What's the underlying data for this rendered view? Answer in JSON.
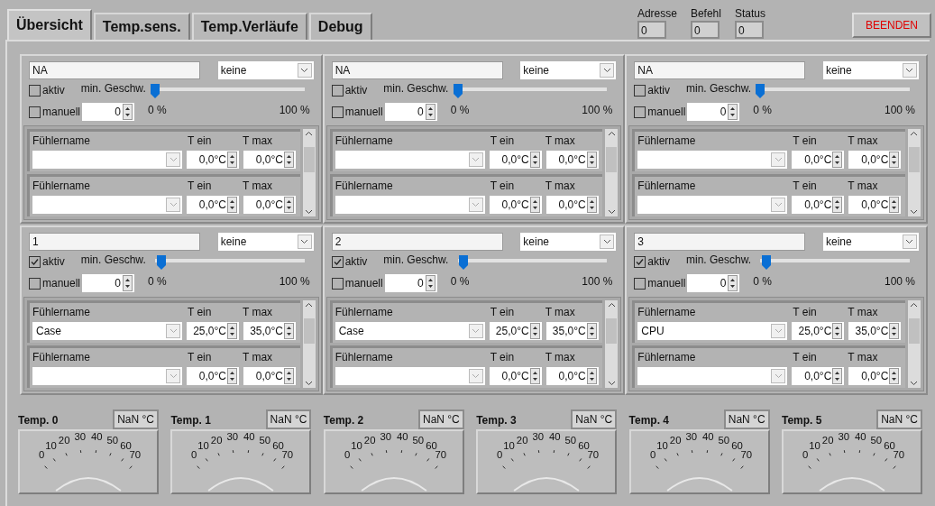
{
  "tabs": [
    {
      "label": "Übersicht",
      "selected": true
    },
    {
      "label": "Temp.sens.",
      "selected": false
    },
    {
      "label": "Temp.Verläufe",
      "selected": false
    },
    {
      "label": "Debug",
      "selected": false
    }
  ],
  "indicators": [
    {
      "label": "Adresse",
      "value": "0"
    },
    {
      "label": "Befehl",
      "value": "0"
    },
    {
      "label": "Status",
      "value": "0"
    }
  ],
  "quit_button": "BEENDEN",
  "panels": [
    {
      "name": "NA",
      "mode": "keine",
      "aktiv_label": "aktiv",
      "aktiv": false,
      "manuell_label": "manuell",
      "manuell": false,
      "manual_value": "0",
      "speed_label": "min. Geschw.",
      "level": 0,
      "scale_min": "0 %",
      "scale_max": "100 %",
      "sensors": [
        {
          "name_label": "Fühlername",
          "t_on_label": "T ein",
          "t_on": "0,0°C",
          "t_max_label": "T max",
          "t_max": "0,0°C"
        },
        {
          "name_label": "Fühlername",
          "t_on_label": "T ein",
          "t_on": "0,0°C",
          "t_max_label": "T max",
          "t_max": "0,0°C"
        }
      ]
    },
    {
      "name": "NA",
      "mode": "keine",
      "aktiv_label": "aktiv",
      "aktiv": false,
      "manuell_label": "manuell",
      "manuell": false,
      "manual_value": "0",
      "speed_label": "min. Geschw.",
      "level": 0,
      "scale_min": "0 %",
      "scale_max": "100 %",
      "sensors": [
        {
          "name_label": "Fühlername",
          "t_on_label": "T ein",
          "t_on": "0,0°C",
          "t_max_label": "T max",
          "t_max": "0,0°C"
        },
        {
          "name_label": "Fühlername",
          "t_on_label": "T ein",
          "t_on": "0,0°C",
          "t_max_label": "T max",
          "t_max": "0,0°C"
        }
      ]
    },
    {
      "name": "NA",
      "mode": "keine",
      "aktiv_label": "aktiv",
      "aktiv": false,
      "manuell_label": "manuell",
      "manuell": false,
      "manual_value": "0",
      "speed_label": "min. Geschw.",
      "level": 0,
      "scale_min": "0 %",
      "scale_max": "100 %",
      "sensors": [
        {
          "name_label": "Fühlername",
          "t_on_label": "T ein",
          "t_on": "0,0°C",
          "t_max_label": "T max",
          "t_max": "0,0°C"
        },
        {
          "name_label": "Fühlername",
          "t_on_label": "T ein",
          "t_on": "0,0°C",
          "t_max_label": "T max",
          "t_max": "0,0°C"
        }
      ]
    },
    {
      "name": "1",
      "mode": "keine",
      "aktiv_label": "aktiv",
      "aktiv": true,
      "manuell_label": "manuell",
      "manuell": false,
      "manual_value": "0",
      "speed_label": "min. Geschw.",
      "level": 0.04,
      "scale_min": "0 %",
      "scale_max": "100 %",
      "sensors": [
        {
          "name_label": "Fühlername",
          "sensor": "Case",
          "t_on_label": "T ein",
          "t_on": "25,0°C",
          "t_max_label": "T max",
          "t_max": "35,0°C"
        },
        {
          "name_label": "Fühlername",
          "t_on_label": "T ein",
          "t_on": "0,0°C",
          "t_max_label": "T max",
          "t_max": "0,0°C"
        }
      ]
    },
    {
      "name": "2",
      "mode": "keine",
      "aktiv_label": "aktiv",
      "aktiv": true,
      "manuell_label": "manuell",
      "manuell": false,
      "manual_value": "0",
      "speed_label": "min. Geschw.",
      "level": 0.04,
      "scale_min": "0 %",
      "scale_max": "100 %",
      "sensors": [
        {
          "name_label": "Fühlername",
          "sensor": "Case",
          "t_on_label": "T ein",
          "t_on": "25,0°C",
          "t_max_label": "T max",
          "t_max": "35,0°C"
        },
        {
          "name_label": "Fühlername",
          "t_on_label": "T ein",
          "t_on": "0,0°C",
          "t_max_label": "T max",
          "t_max": "0,0°C"
        }
      ]
    },
    {
      "name": "3",
      "mode": "keine",
      "aktiv_label": "aktiv",
      "aktiv": true,
      "manuell_label": "manuell",
      "manuell": false,
      "manual_value": "0",
      "speed_label": "min. Geschw.",
      "level": 0.04,
      "scale_min": "0 %",
      "scale_max": "100 %",
      "sensors": [
        {
          "name_label": "Fühlername",
          "sensor": "CPU",
          "t_on_label": "T ein",
          "t_on": "25,0°C",
          "t_max_label": "T max",
          "t_max": "35,0°C"
        },
        {
          "name_label": "Fühlername",
          "t_on_label": "T ein",
          "t_on": "0,0°C",
          "t_max_label": "T max",
          "t_max": "0,0°C"
        }
      ]
    }
  ],
  "gauges": [
    {
      "title": "Temp. 0",
      "reading": "NaN °C",
      "scale": [
        "0",
        "10",
        "20",
        "30",
        "40",
        "50",
        "60",
        "70"
      ]
    },
    {
      "title": "Temp. 1",
      "reading": "NaN °C",
      "scale": [
        "0",
        "10",
        "20",
        "30",
        "40",
        "50",
        "60",
        "70"
      ]
    },
    {
      "title": "Temp. 2",
      "reading": "NaN °C",
      "scale": [
        "0",
        "10",
        "20",
        "30",
        "40",
        "50",
        "60",
        "70"
      ]
    },
    {
      "title": "Temp. 3",
      "reading": "NaN °C",
      "scale": [
        "0",
        "10",
        "20",
        "30",
        "40",
        "50",
        "60",
        "70"
      ]
    },
    {
      "title": "Temp. 4",
      "reading": "NaN °C",
      "scale": [
        "0",
        "10",
        "20",
        "30",
        "40",
        "50",
        "60",
        "70"
      ]
    },
    {
      "title": "Temp. 5",
      "reading": "NaN °C",
      "scale": [
        "0",
        "10",
        "20",
        "30",
        "40",
        "50",
        "60",
        "70"
      ]
    }
  ]
}
